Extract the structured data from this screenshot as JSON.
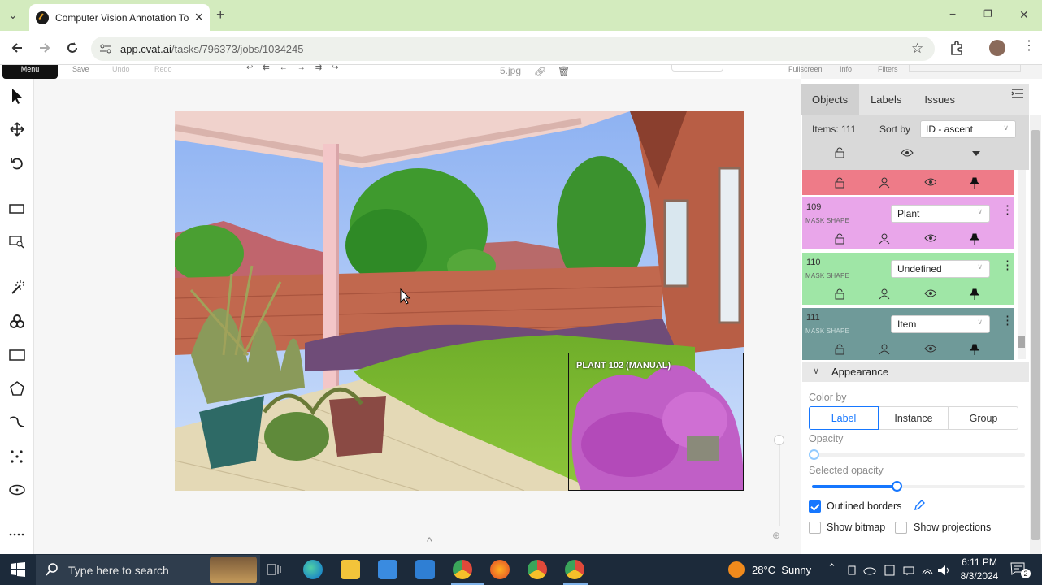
{
  "browser": {
    "tab_title": "Computer Vision Annotation To",
    "url_host": "app.cvat.ai",
    "url_path": "/tasks/796373/jobs/1034245",
    "new_tab_label": "+",
    "close_tab_label": "×"
  },
  "window_controls": {
    "minimize": "−",
    "restore": "❐",
    "close": "✕"
  },
  "toolbar": {
    "menu": "Menu",
    "save": "Save",
    "undo": "Undo",
    "redo": "Redo",
    "filename": "5.jpg",
    "fullscreen": "Fullscreen",
    "info": "Info",
    "filters": "Filters"
  },
  "canvas": {
    "box_label": "PLANT 102 (MANUAL)"
  },
  "sidebar": {
    "tabs": [
      {
        "label": "Objects"
      },
      {
        "label": "Labels"
      },
      {
        "label": "Issues"
      }
    ],
    "items_count": "Items: 111",
    "sort_by_label": "Sort by",
    "sort_value": "ID - ascent",
    "objects": [
      {
        "id": "109",
        "kind": "MASK SHAPE",
        "label": "Plant",
        "color": "#e9a6ea"
      },
      {
        "id": "110",
        "kind": "MASK SHAPE",
        "label": "Undefined",
        "color": "#9fe6a6"
      },
      {
        "id": "111",
        "kind": "MASK SHAPE",
        "label": "Item",
        "color": "#6f9a99"
      }
    ],
    "partial_object_color": "#ee7b88",
    "appearance": {
      "title": "Appearance",
      "color_by_label": "Color by",
      "color_by_options": [
        "Label",
        "Instance",
        "Group"
      ],
      "color_by_selected": "Label",
      "opacity_label": "Opacity",
      "opacity_value": 0.0,
      "selected_opacity_label": "Selected opacity",
      "selected_opacity_value": 0.4,
      "outlined_borders": "Outlined borders",
      "outlined_borders_checked": true,
      "show_bitmap": "Show bitmap",
      "show_bitmap_checked": false,
      "show_projections": "Show projections",
      "show_projections_checked": false
    }
  },
  "taskbar": {
    "search_placeholder": "Type here to search",
    "weather": "28°C  Sunny",
    "time": "6:11 PM",
    "date": "8/3/2024",
    "notification_count": "2"
  }
}
